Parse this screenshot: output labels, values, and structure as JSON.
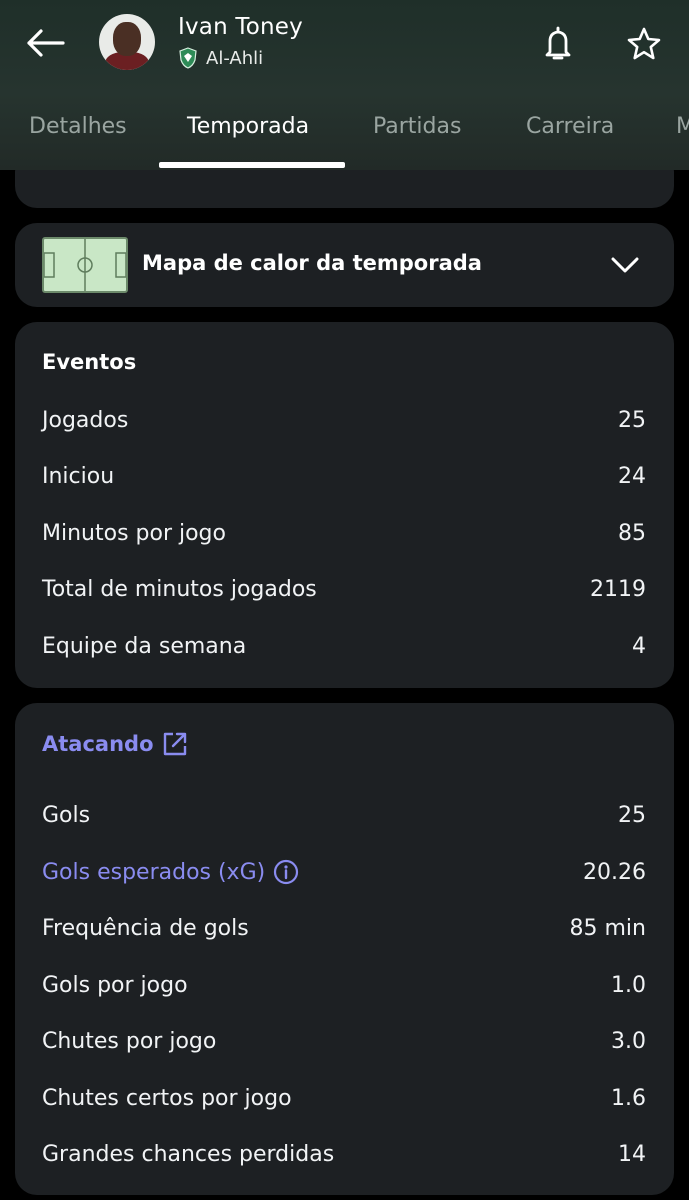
{
  "header": {
    "player_name": "Ivan Toney",
    "team_name": "Al-Ahli"
  },
  "icons": {
    "back": "arrow-left-icon",
    "notification": "bell-icon",
    "favorite": "star-icon",
    "team_badge": "al-ahli-badge-icon",
    "heatmap": "pitch-icon",
    "expand": "chevron-down-icon",
    "external_link": "external-link-icon",
    "info": "info-icon"
  },
  "tabs": [
    {
      "label": "Detalhes"
    },
    {
      "label": "Temporada"
    },
    {
      "label": "Partidas"
    },
    {
      "label": "Carreira"
    },
    {
      "label": "M"
    }
  ],
  "active_tab": "Temporada",
  "heatmap": {
    "title": "Mapa de calor da temporada"
  },
  "events": {
    "title": "Eventos",
    "rows": [
      {
        "label": "Jogados",
        "value": "25"
      },
      {
        "label": "Iniciou",
        "value": "24"
      },
      {
        "label": "Minutos por jogo",
        "value": "85"
      },
      {
        "label": "Total de minutos jogados",
        "value": "2119"
      },
      {
        "label": "Equipe da semana",
        "value": "4"
      }
    ]
  },
  "attacking": {
    "title": "Atacando",
    "rows": [
      {
        "label": "Gols",
        "value": "25"
      },
      {
        "label": "Gols esperados (xG)",
        "value": "20.26"
      },
      {
        "label": "Frequência de gols",
        "value": "85 min"
      },
      {
        "label": "Gols por jogo",
        "value": "1.0"
      },
      {
        "label": "Chutes por jogo",
        "value": "3.0"
      },
      {
        "label": "Chutes certos por jogo",
        "value": "1.6"
      },
      {
        "label": "Grandes chances perdidas",
        "value": "14"
      }
    ]
  },
  "colors": {
    "background": "#000000",
    "card": "#1d2023",
    "header": "#26342f",
    "link": "#8a8cf0",
    "text": "#f1f3f5",
    "tab_inactive": "#9aa5a1"
  }
}
